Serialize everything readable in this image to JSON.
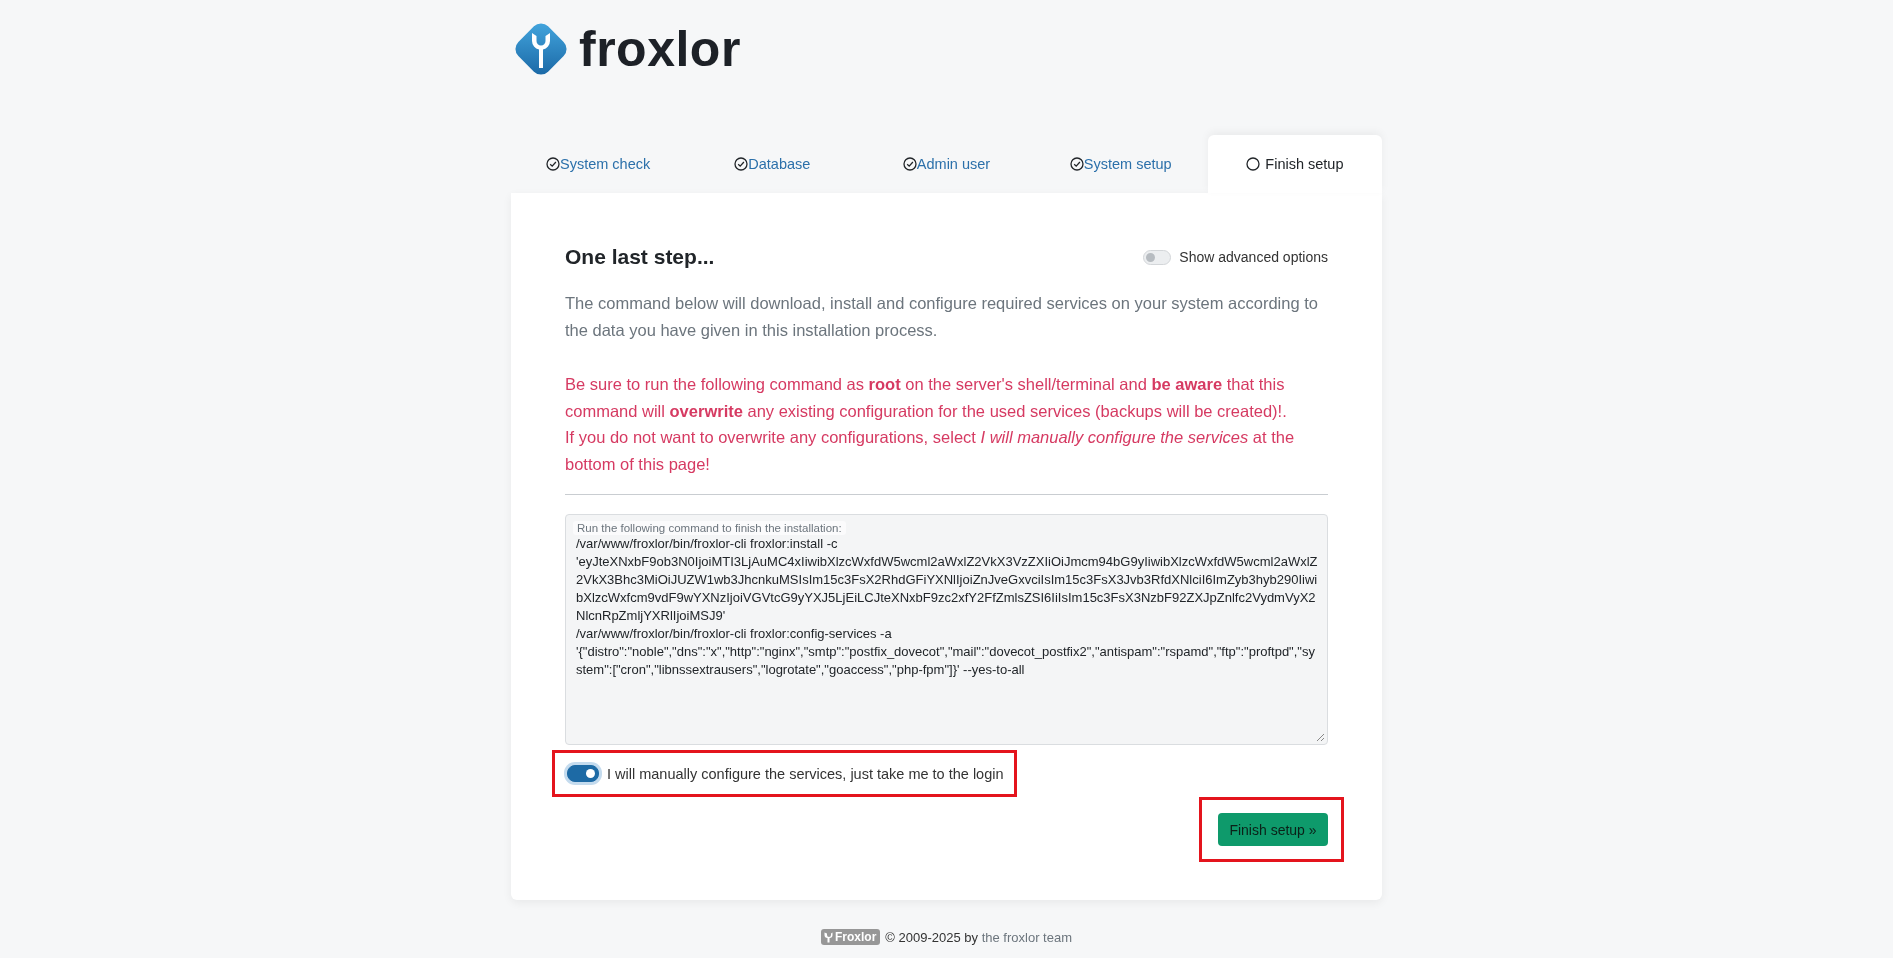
{
  "logo": {
    "text": "froxlor"
  },
  "tabs": [
    {
      "label": "System check",
      "selected": false,
      "done": true
    },
    {
      "label": "Database",
      "selected": false,
      "done": true
    },
    {
      "label": "Admin user",
      "selected": false,
      "done": true
    },
    {
      "label": "System setup",
      "selected": false,
      "done": true
    },
    {
      "label": "Finish setup",
      "selected": true,
      "done": false
    }
  ],
  "card": {
    "title": "One last step...",
    "advanced_toggle": {
      "label": "Show advanced options",
      "checked": false
    },
    "intro": "The command below will download, install and configure required services on your system according to the data you have given in this installation process.",
    "warning": "Be sure to run the following command as **root** on the server's shell/terminal and **be aware** that this command will **overwrite** any existing configuration for the used services (backups will be created)!.\nIf you do not want to overwrite any configurations, select *I will manually configure the services* at the bottom of this page!",
    "command_field": {
      "label": "Run the following command to finish the installation:",
      "value": "/var/www/froxlor/bin/froxlor-cli froxlor:install -c 'eyJteXNxbF9ob3N0IjoiMTI3LjAuMC4xIiwibXlzcWxfdW5wcml2aWxlZ2VkX3VzZXIiOiJmcm94bG9yIiwibXlzcWxfdW5wcml2aWxlZ2VkX3Bhc3MiOiJUZW1wb3JhcnkuMSIsIm15c3FsX2RhdGFiYXNlIjoiZnJveGxvciIsIm15c3FsX3Jvb3RfdXNlciI6ImZyb3hyb290IiwibXlzcWxfcm9vdF9wYXNzIjoiVGVtcG9yYXJ5LjEiLCJteXNxbF9zc2xfY2FfZmlsZSI6IiIsIm15c3FsX3NzbF92ZXJpZnlfc2VydmVyX2NlcnRpZmljYXRlIjoiMSJ9'\n/var/www/froxlor/bin/froxlor-cli froxlor:config-services -a '{\"distro\":\"noble\",\"dns\":\"x\",\"http\":\"nginx\",\"smtp\":\"postfix_dovecot\",\"mail\":\"dovecot_postfix2\",\"antispam\":\"rspamd\",\"ftp\":\"proftpd\",\"system\":[\"cron\",\"libnssextrausers\",\"logrotate\",\"goaccess\",\"php-fpm\"]}' --yes-to-all"
    },
    "manual_config": {
      "label": "I will manually configure the services, just take me to the login",
      "checked": true,
      "highlighted": true
    },
    "finish_button": {
      "label": "Finish setup »",
      "highlighted": true
    }
  },
  "footer": {
    "badge": "Froxlor",
    "copyright": "© 2009-2025 by",
    "link": "the froxlor team"
  }
}
